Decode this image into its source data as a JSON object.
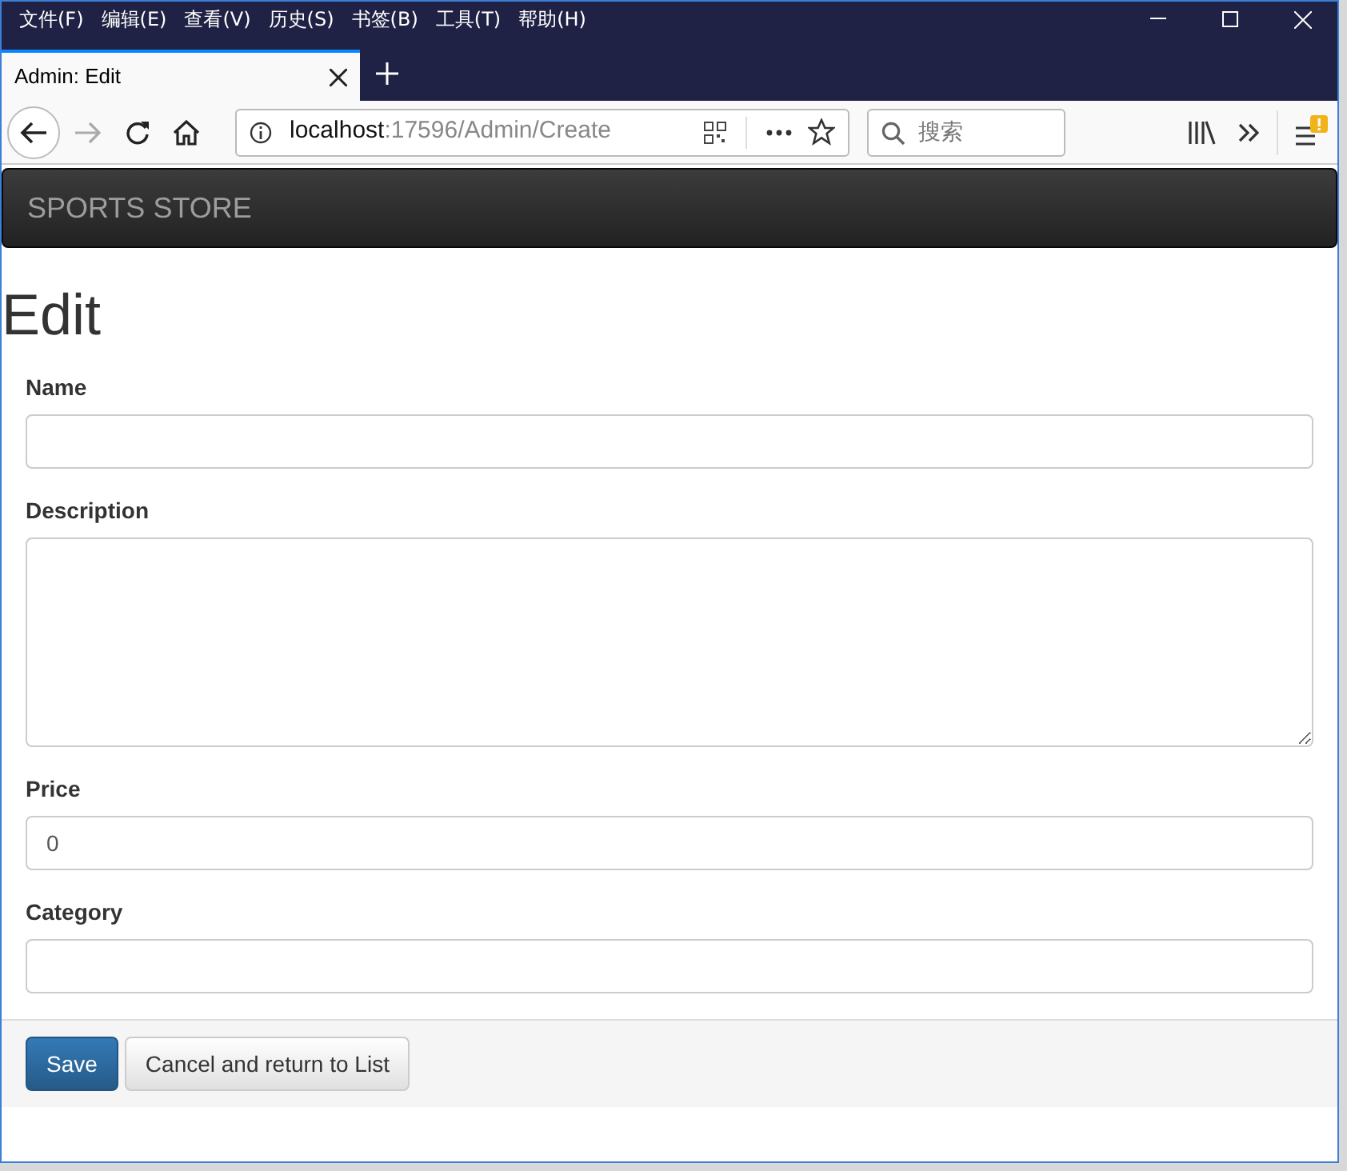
{
  "menu_bar": [
    "文件(F)",
    "编辑(E)",
    "查看(V)",
    "历史(S)",
    "书签(B)",
    "工具(T)",
    "帮助(H)"
  ],
  "tabs": [
    {
      "label": "Admin: Edit",
      "selected": true
    }
  ],
  "address_bar": {
    "host": "localhost",
    "path": ":17596/Admin/Create"
  },
  "search": {
    "placeholder": "搜索"
  },
  "navbar": {
    "brand": "SPORTS STORE"
  },
  "page": {
    "heading": "Edit"
  },
  "fields": [
    {
      "label": "Name",
      "kind": "input"
    },
    {
      "label": "Description",
      "kind": "textarea"
    },
    {
      "label": "Price",
      "kind": "input",
      "value": "0"
    },
    {
      "label": "Category",
      "kind": "input"
    }
  ],
  "buttons": [
    {
      "label": "Save",
      "kind": "primary"
    },
    {
      "label": "Cancel and return to List",
      "kind": "default"
    }
  ]
}
